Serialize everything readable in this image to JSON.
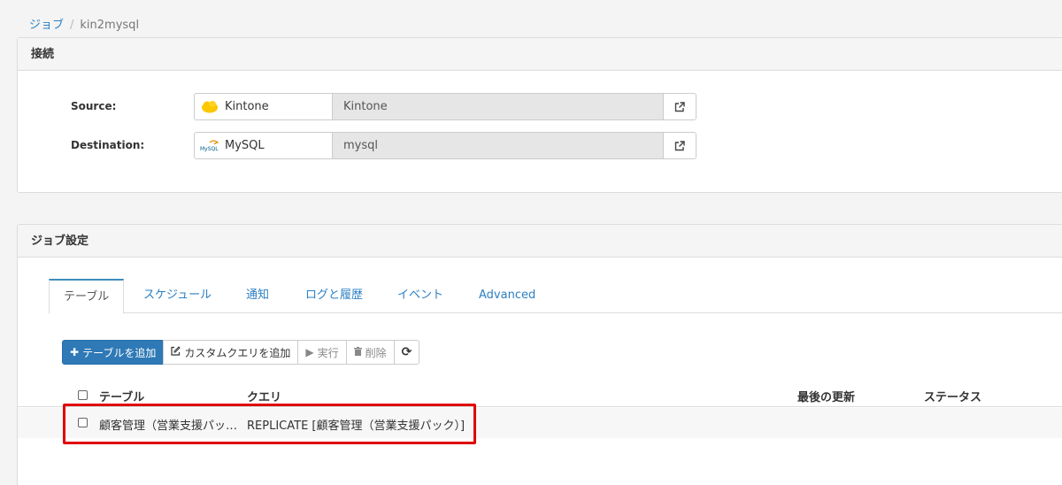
{
  "breadcrumb": {
    "parent": "ジョブ",
    "separator": "/",
    "current": "kin2mysql"
  },
  "connection": {
    "title": "接続",
    "source": {
      "label": "Source:",
      "name": "Kintone",
      "value": "Kintone",
      "icon": "kintone-icon"
    },
    "destination": {
      "label": "Destination:",
      "name": "MySQL",
      "value": "mysql",
      "icon": "mysql-icon"
    }
  },
  "job_settings": {
    "title": "ジョブ設定",
    "tabs": [
      {
        "label": "テーブル",
        "active": true
      },
      {
        "label": "スケジュール"
      },
      {
        "label": "通知"
      },
      {
        "label": "ログと履歴"
      },
      {
        "label": "イベント"
      },
      {
        "label": "Advanced"
      }
    ],
    "toolbar": {
      "add_table": "テーブルを追加",
      "add_custom_query": "カスタムクエリを追加",
      "run": "実行",
      "delete": "削除"
    },
    "columns": {
      "table": "テーブル",
      "query": "クエリ",
      "last_updated": "最後の更新",
      "status": "ステータス"
    },
    "rows": [
      {
        "table": "顧客管理（営業支援パッ…",
        "query": "REPLICATE [顧客管理（営業支援パック）]",
        "last_updated": "",
        "status": ""
      }
    ]
  },
  "colors": {
    "link": "#2b7fc3",
    "primary_button": "#2e79b6",
    "highlight": "#e00000"
  }
}
